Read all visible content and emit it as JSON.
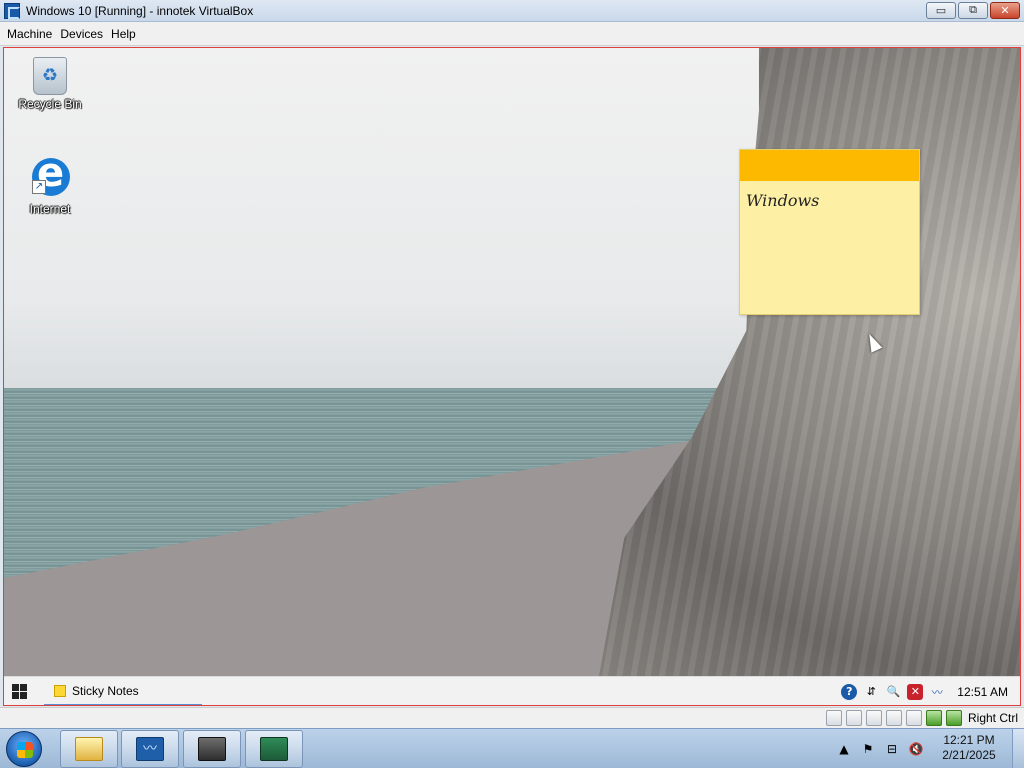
{
  "vbox": {
    "title": "Windows 10 [Running] - innotek VirtualBox",
    "menu": [
      "Machine",
      "Devices",
      "Help"
    ],
    "controls": {
      "minimize": "▭",
      "maximize": "⧉",
      "close": "✕"
    },
    "status": {
      "host_key": "Right Ctrl"
    }
  },
  "guest": {
    "desktop_icons": [
      {
        "label": "Recycle Bin",
        "icon": "recycle-bin-icon"
      },
      {
        "label": "Internet",
        "icon": "edge-icon"
      }
    ],
    "sticky_note": {
      "text": "Windows",
      "header_color": "#fdb900",
      "body_color": "#fdf0a5"
    },
    "taskbar": {
      "active_app": "Sticky Notes",
      "clock": "12:51 AM",
      "tray_icons": [
        "help-icon",
        "network-icon",
        "search-icon",
        "shield-error-icon",
        "vbox-monitor-icon"
      ]
    }
  },
  "host": {
    "taskbar": {
      "pinned": [
        "explorer-icon",
        "vbox-monitor-icon",
        "virtualbox-icon",
        "monitor-icon"
      ],
      "clock_time": "12:21 PM",
      "clock_date": "2/21/2025",
      "tray_icons": [
        "chevron-up-icon",
        "flag-icon",
        "network-icon",
        "volume-muted-icon"
      ]
    }
  },
  "colors": {
    "guest_border": "#e0403c",
    "accent": "#1a5aa8"
  }
}
